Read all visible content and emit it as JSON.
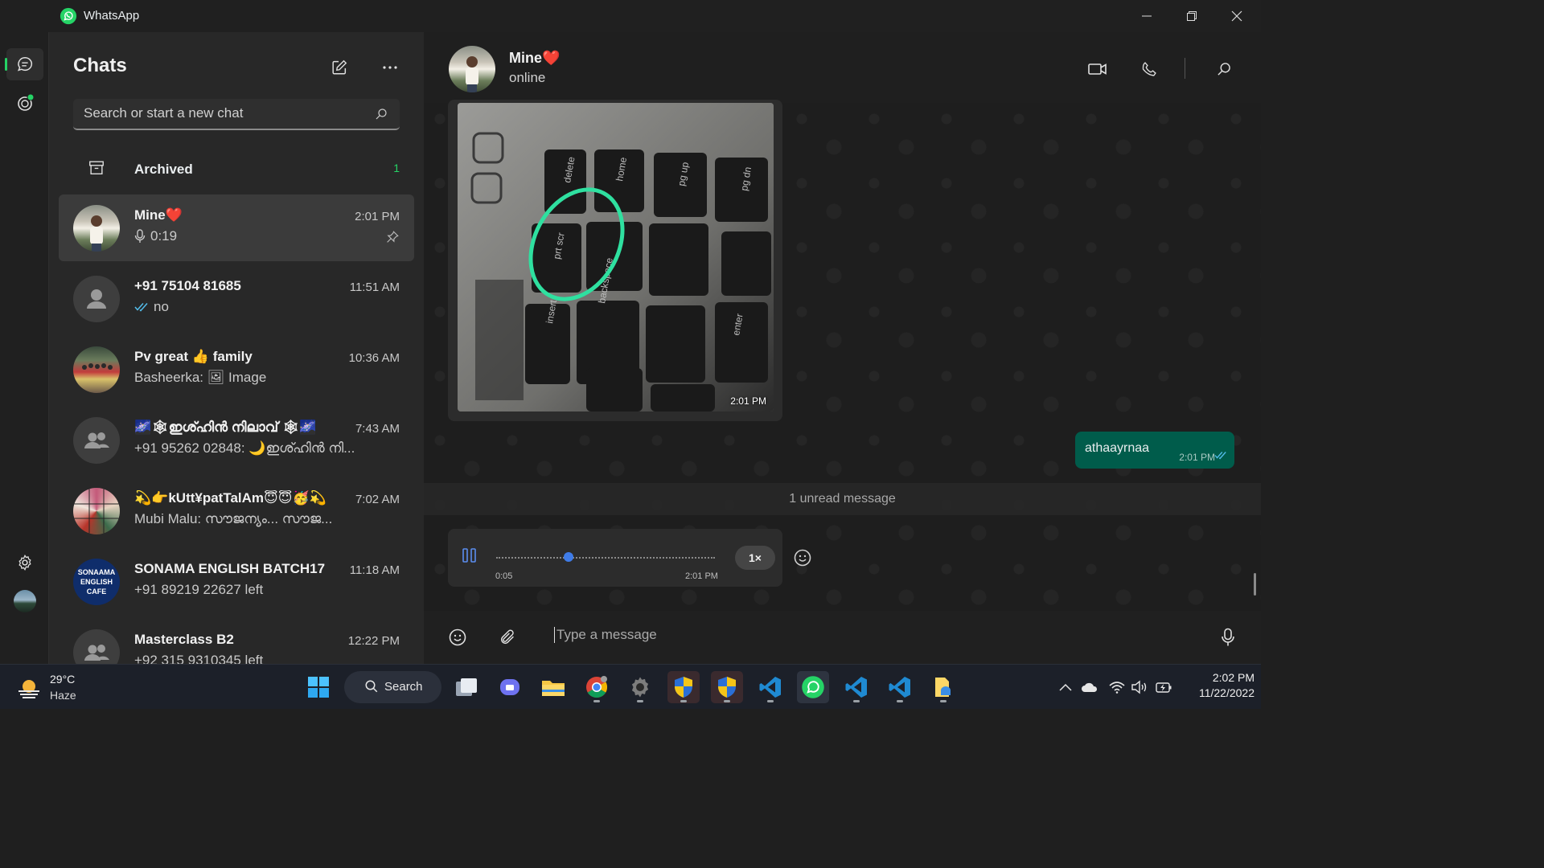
{
  "window": {
    "app_title": "WhatsApp"
  },
  "rail": {
    "items": [
      "chats-icon",
      "status-icon",
      "settings-icon",
      "profile-avatar"
    ]
  },
  "panel": {
    "title": "Chats",
    "search_placeholder": "Search or start a new chat",
    "archived_label": "Archived",
    "archived_count": "1"
  },
  "chats": [
    {
      "name": "Mine❤️",
      "time": "2:01 PM",
      "preview": "0:19",
      "preview_icon": "mic-icon",
      "pinned": true
    },
    {
      "name": "+91 75104 81685",
      "time": "11:51 AM",
      "preview": "no",
      "preview_icon": "double-check-icon"
    },
    {
      "name": "Pv great 👍 family",
      "time": "10:36 AM",
      "preview": "Basheerka: 🖼 Image"
    },
    {
      "name": "🌌🕸ഇശ്ഹിൻ നിലാവ് 🕸🌌",
      "time": "7:43 AM",
      "preview": "+91 95262 02848: 🌙ഇശ്ഹിൻ നി..."
    },
    {
      "name": "💫👉kUtt¥patTalAm😇😇🥳💫",
      "time": "7:02 AM",
      "preview": "Mubi Malu: സൗജന്യം...  സൗജ..."
    },
    {
      "name": "SONAMA ENGLISH BATCH17",
      "time": "11:18 AM",
      "preview": "+91 89219 22627 left",
      "avatar_text": "SONAAMA ENGLISH CAFE"
    },
    {
      "name": "Masterclass B2",
      "time": "12:22 PM",
      "preview": "+92 315 9310345 left"
    }
  ],
  "conversation": {
    "name": "Mine❤️",
    "status": "online",
    "image_time": "2:01 PM",
    "image_key_labels": [
      "delete",
      "home",
      "pg up",
      "pg dn",
      "prt scr",
      "backspace",
      "insert",
      "enter"
    ],
    "outgoing_text": "athaayrnaa",
    "outgoing_time": "2:01 PM",
    "unread_banner": "1 unread message",
    "voice": {
      "elapsed": "0:05",
      "time": "2:01 PM",
      "speed": "1×",
      "progress": 0.33
    },
    "composer_placeholder": "Type a message"
  },
  "taskbar": {
    "weather_temp": "29°C",
    "weather_cond": "Haze",
    "search_label": "Search",
    "clock_time": "2:02 PM",
    "clock_date": "11/22/2022"
  },
  "colors": {
    "accent_green": "#25d366",
    "outgoing_bubble": "#005c4b",
    "progress_blue": "#3f7ce8"
  }
}
